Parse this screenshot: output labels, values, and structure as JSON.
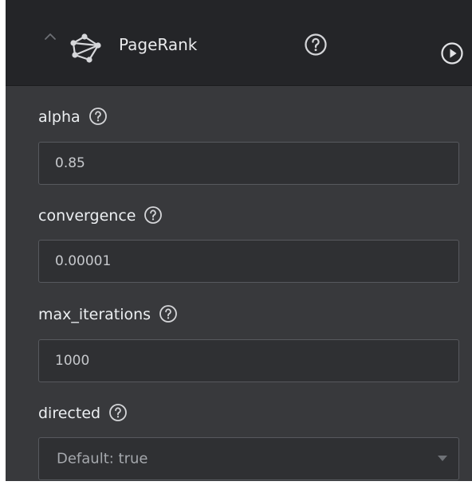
{
  "header": {
    "title": "PageRank",
    "icons": {
      "collapse": "chevron-up-icon",
      "algorithm": "graph-network-icon",
      "help": "question-circle-icon",
      "run": "play-circle-icon"
    }
  },
  "params": [
    {
      "name": "alpha",
      "value": "0.85",
      "control": "text"
    },
    {
      "name": "convergence",
      "value": "0.00001",
      "control": "text"
    },
    {
      "name": "max_iterations",
      "value": "1000",
      "control": "text"
    },
    {
      "name": "directed",
      "value": "Default: true",
      "control": "select"
    }
  ],
  "colors": {
    "header_bg": "#242528",
    "panel_bg": "#38393c",
    "field_bg": "#2f3033",
    "field_border": "#57595e",
    "label_text": "#eceff2",
    "value_text": "#c6c8cc"
  }
}
